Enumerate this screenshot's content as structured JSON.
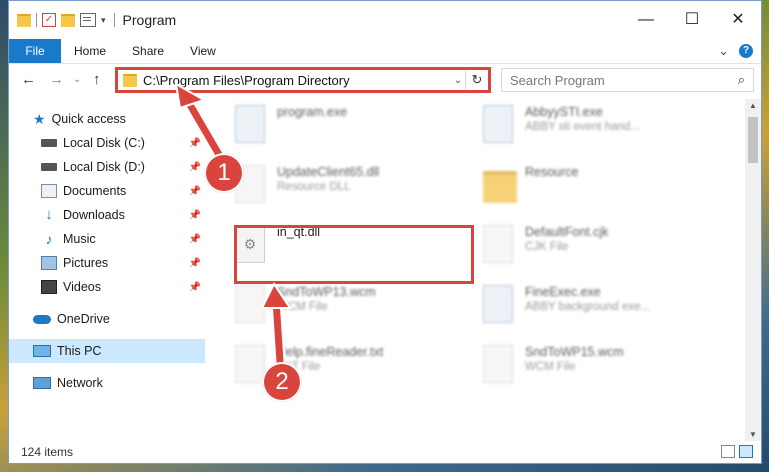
{
  "window": {
    "title": "Program"
  },
  "controls": {
    "minimize": "—",
    "maximize": "☐",
    "close": "✕"
  },
  "ribbon": {
    "tabs": [
      "File",
      "Home",
      "Share",
      "View"
    ],
    "expand": "⌄",
    "help": "?"
  },
  "nav": {
    "back": "←",
    "forward": "→",
    "recent": "⌄",
    "up": "↑",
    "address": "C:\\Program Files\\Program Directory",
    "refresh": "↻",
    "search_placeholder": "Search Program",
    "search_icon": "search-icon"
  },
  "sidebar": {
    "items": [
      {
        "label": "Quick access",
        "icon": "star-icon"
      },
      {
        "label": "Local Disk (C:)",
        "icon": "drive-icon",
        "pinned": true
      },
      {
        "label": "Local Disk (D:)",
        "icon": "drive-icon",
        "pinned": true
      },
      {
        "label": "Documents",
        "icon": "documents-icon",
        "pinned": true
      },
      {
        "label": "Downloads",
        "icon": "downloads-icon",
        "pinned": true
      },
      {
        "label": "Music",
        "icon": "music-icon",
        "pinned": true
      },
      {
        "label": "Pictures",
        "icon": "pictures-icon",
        "pinned": true
      },
      {
        "label": "Videos",
        "icon": "videos-icon",
        "pinned": true
      },
      {
        "label": "OneDrive",
        "icon": "cloud-icon"
      },
      {
        "label": "This PC",
        "icon": "computer-icon",
        "selected": true
      },
      {
        "label": "Network",
        "icon": "network-icon"
      }
    ]
  },
  "files": {
    "left": [
      {
        "name": "program.exe",
        "desc": ""
      },
      {
        "name": "UpdateClient65.dll",
        "desc": "Resource DLL"
      },
      {
        "name": "in_qt.dll",
        "desc": ""
      },
      {
        "name": "SndToWP13.wcm",
        "desc": "WCM File"
      },
      {
        "name": "Help.fineReader.txt",
        "desc": "TXT File"
      }
    ],
    "right": [
      {
        "name": "AbbyySTI.exe",
        "desc": "ABBY sti event hand..."
      },
      {
        "name": "Resource",
        "desc": ""
      },
      {
        "name": "DefaultFont.cjk",
        "desc": "CJK File"
      },
      {
        "name": "FineExec.exe",
        "desc": "ABBY background exe..."
      },
      {
        "name": "SndToWP15.wcm",
        "desc": "WCM File"
      }
    ]
  },
  "status": {
    "count": "124 items"
  },
  "callouts": {
    "step1": "1",
    "step2": "2"
  },
  "colors": {
    "accent": "#1979ca",
    "highlight": "#d9453d",
    "selected": "#cce8ff"
  }
}
